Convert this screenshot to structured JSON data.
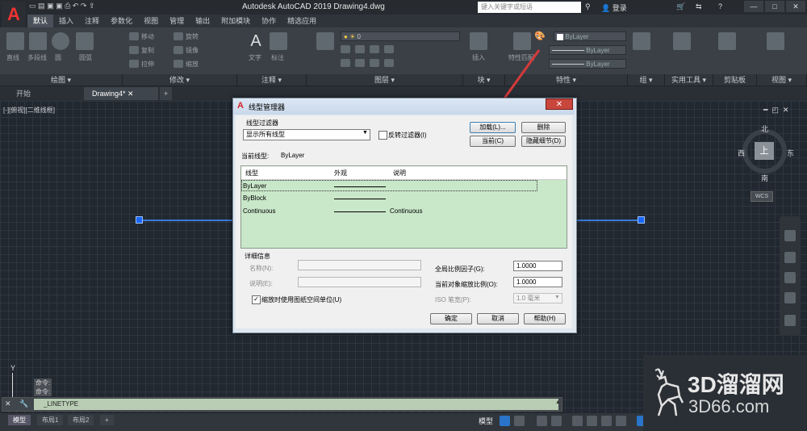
{
  "app": {
    "logo_letter": "A",
    "title": "Autodesk AutoCAD 2019    Drawing4.dwg",
    "search_placeholder": "键入关键字或短语",
    "login": "登录",
    "window_buttons": [
      "—",
      "□",
      "✕"
    ]
  },
  "ribbon": {
    "tabs": [
      "默认",
      "插入",
      "注释",
      "参数化",
      "视图",
      "管理",
      "输出",
      "附加模块",
      "协作",
      "精选应用"
    ],
    "active_tab": "默认",
    "groups": [
      "绘图",
      "修改",
      "注释",
      "图层",
      "块",
      "特性",
      "组",
      "实用工具",
      "剪贴板",
      "视图"
    ],
    "small_labels": [
      "直线",
      "多段线",
      "圆",
      "圆弧",
      "移动",
      "旋转",
      "复制",
      "镜像",
      "拉伸",
      "缩放",
      "文字",
      "标注",
      "插入",
      "特性匹配"
    ],
    "layer_value": "0",
    "prop_bylayer": [
      "ByLayer",
      "ByLayer",
      "ByLayer"
    ]
  },
  "doc_tabs": {
    "start": "开始",
    "drawing": "Drawing4*",
    "add": "+"
  },
  "viewport": {
    "label": "[-][俯视][二维线框]",
    "viewcube": {
      "n": "北",
      "s": "南",
      "w": "西",
      "e": "东",
      "top": "上",
      "wcs": "WCS"
    },
    "ucs_y": "Y"
  },
  "command": {
    "history": [
      "命令:",
      "命令:"
    ],
    "input": "_LINETYPE",
    "icons": "✕ 🔧"
  },
  "status": {
    "layout_tabs": [
      "模型",
      "布局1",
      "布局2"
    ],
    "add": "+",
    "model": "模型"
  },
  "dialog": {
    "title": "线型管理器",
    "close": "✕",
    "filter_label": "线型过滤器",
    "filter_value": "显示所有线型",
    "invert_label": "反转过滤器(I)",
    "buttons": {
      "load": "加载(L)...",
      "delete": "删除",
      "current": "当前(C)",
      "hide_details": "隐藏细节(D)",
      "ok": "确定",
      "cancel": "取消",
      "help": "帮助(H)"
    },
    "current_label": "当前线型:",
    "current_value": "ByLayer",
    "columns": [
      "线型",
      "外观",
      "说明"
    ],
    "rows": [
      {
        "name": "ByLayer",
        "desc": ""
      },
      {
        "name": "ByBlock",
        "desc": ""
      },
      {
        "name": "Continuous",
        "desc": "Continuous"
      }
    ],
    "details_label": "详细信息",
    "name_label": "名称(N):",
    "desc_label": "说明(E):",
    "paper_units": "缩放时使用图纸空间单位(U)",
    "paper_checked": "✓",
    "global_scale_label": "全局比例因子(G):",
    "global_scale_value": "1.0000",
    "object_scale_label": "当前对象缩放比例(O):",
    "object_scale_value": "1.0000",
    "iso_label": "ISO 笔宽(P):",
    "iso_value": "1.0 毫米"
  },
  "watermark": {
    "line1": "3D溜溜网",
    "line2": "3D66.com"
  },
  "colors": {
    "accent_red": "#d9232a",
    "arrow": "#d43a3a",
    "list_bg": "#c9e7c9",
    "line_blue": "#3a7bd5"
  }
}
